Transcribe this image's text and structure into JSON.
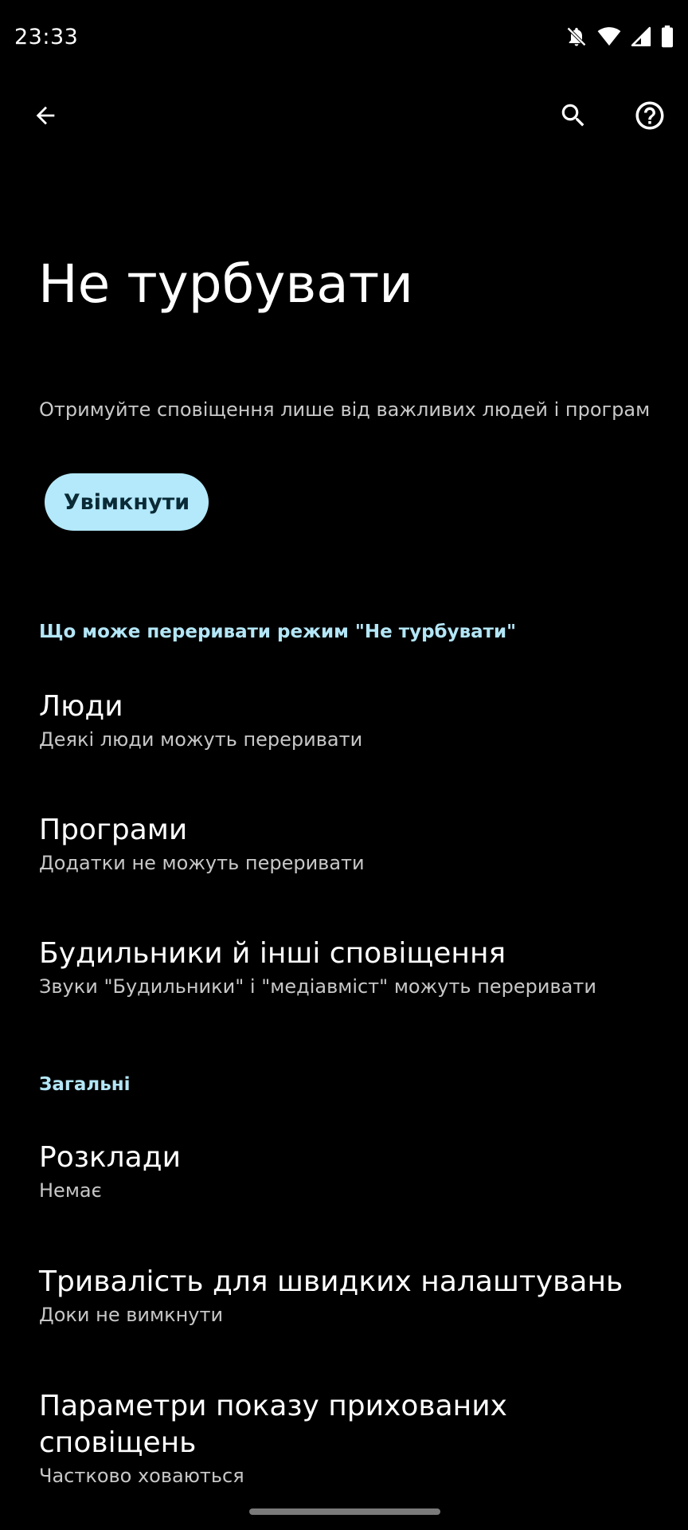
{
  "status_bar": {
    "time": "23:33",
    "icons": [
      "notifications-off-icon",
      "wifi-icon",
      "cellular-signal-icon",
      "battery-icon"
    ]
  },
  "app_bar": {
    "icons": [
      "back-arrow-icon",
      "search-icon",
      "help-icon"
    ]
  },
  "header": {
    "title": "Не турбувати",
    "subtitle": "Отримуйте сповіщення лише від важливих людей і програм",
    "turn_on_label": "Увімкнути"
  },
  "sections": [
    {
      "header": "Що може переривати режим \"Не турбувати\"",
      "items": [
        {
          "title": "Люди",
          "summary": "Деякі люди можуть переривати"
        },
        {
          "title": "Програми",
          "summary": "Додатки не можуть переривати"
        },
        {
          "title": "Будильники й інші сповіщення",
          "summary": "Звуки \"Будильники\" і \"медіавміст\" можуть переривати"
        }
      ]
    },
    {
      "header": "Загальні",
      "items": [
        {
          "title": "Розклади",
          "summary": "Немає"
        },
        {
          "title": "Тривалість для швидких налаштувань",
          "summary": "Доки не вимкнути"
        },
        {
          "title_line1": "Параметри показу прихованих",
          "title_line2": "сповіщень",
          "summary": "Частково ховаються"
        }
      ]
    }
  ],
  "colors": {
    "background": "#000000",
    "accent_button": "#b3e9fb",
    "section_header": "#b3e6f7",
    "summary_text": "#c7c7c7"
  }
}
